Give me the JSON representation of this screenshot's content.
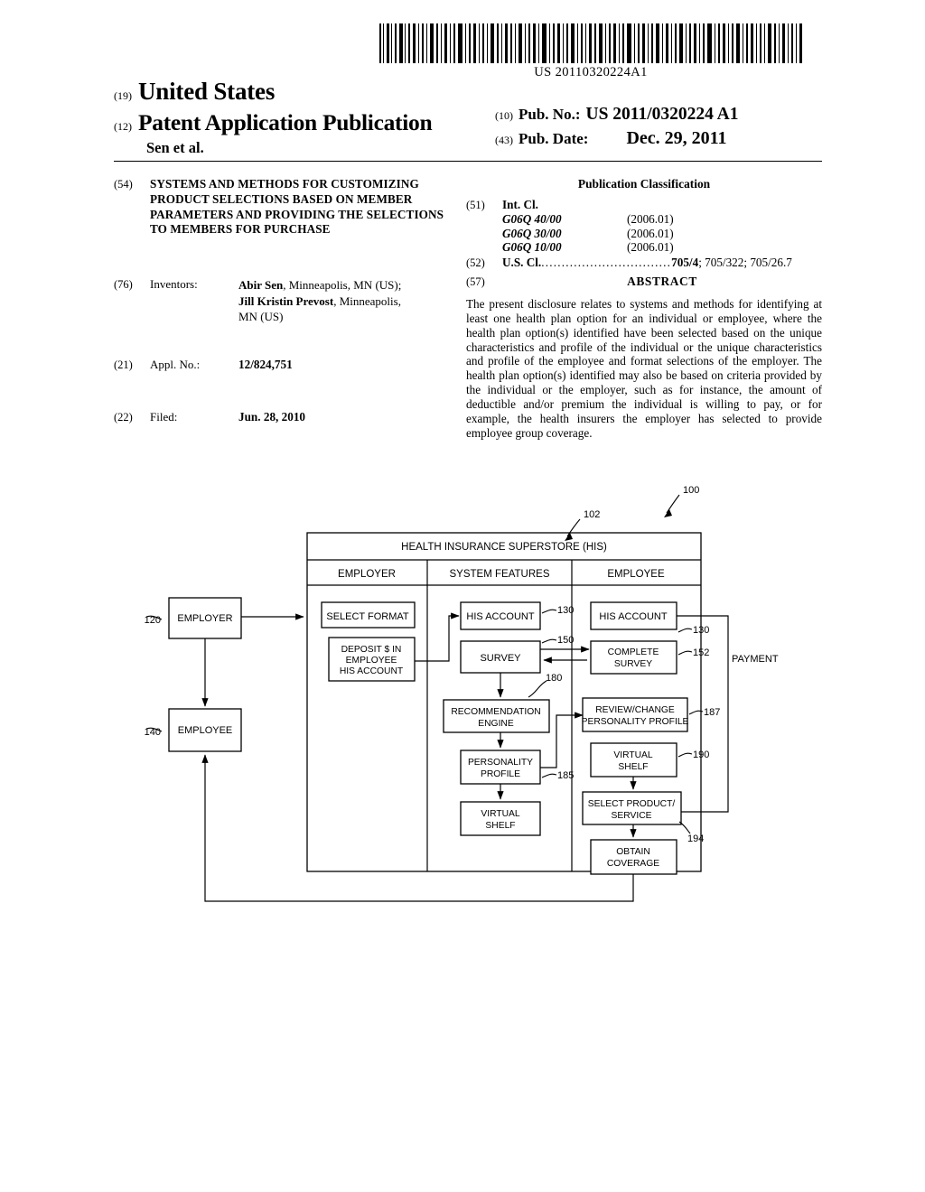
{
  "header": {
    "barcode_number": "US 20110320224A1",
    "country_code": "(19)",
    "country": "United States",
    "doc_code": "(12)",
    "doc_type": "Patent Application Publication",
    "byline": "Sen et al.",
    "pubno_code": "(10)",
    "pubno_label": "Pub. No.:",
    "pubno_value": "US 2011/0320224 A1",
    "pubdate_code": "(43)",
    "pubdate_label": "Pub. Date:",
    "pubdate_value": "Dec. 29, 2011"
  },
  "left_column": {
    "title_code": "(54)",
    "title": "SYSTEMS AND METHODS FOR CUSTOMIZING PRODUCT SELECTIONS BASED ON MEMBER PARAMETERS AND PROVIDING THE SELECTIONS TO MEMBERS FOR PURCHASE",
    "inventors_code": "(76)",
    "inventors_label": "Inventors:",
    "inventors": [
      {
        "name": "Abir Sen",
        "rest": ", Minneapolis, MN (US);"
      },
      {
        "name": "Jill Kristin Prevost",
        "rest": ", Minneapolis,"
      },
      {
        "name": "",
        "rest": "MN (US)"
      }
    ],
    "applno_code": "(21)",
    "applno_label": "Appl. No.:",
    "applno_value": "12/824,751",
    "filed_code": "(22)",
    "filed_label": "Filed:",
    "filed_value": "Jun. 28, 2010"
  },
  "right_column": {
    "pubclass_title": "Publication Classification",
    "intcl_code": "(51)",
    "intcl_label": "Int. Cl.",
    "intcl_entries": [
      {
        "code": "G06Q 40/00",
        "year": "(2006.01)"
      },
      {
        "code": "G06Q 30/00",
        "year": "(2006.01)"
      },
      {
        "code": "G06Q 10/00",
        "year": "(2006.01)"
      }
    ],
    "uscl_code": "(52)",
    "uscl_label": "U.S. Cl.",
    "uscl_dots": "................................",
    "uscl_primary": "705/4",
    "uscl_rest": "; 705/322; 705/26.7",
    "abstract_code": "(57)",
    "abstract_head": "ABSTRACT",
    "abstract_body": "The present disclosure relates to systems and methods for identifying at least one health plan option for an individual or employee, where the health plan option(s) identified have been selected based on the unique characteristics and profile of the individual or the unique characteristics and profile of the employee and format selections of the employer. The health plan option(s) identified may also be based on criteria provided by the individual or the employer, such as for instance, the amount of deductible and/or premium the individual is willing to pay, or for example, the health insurers the employer has selected to provide employee group coverage."
  },
  "figure": {
    "ref_100": "100",
    "ref_102": "102",
    "ref_120": "120",
    "ref_140": "140",
    "his_header": "HEALTH INSURANCE SUPERSTORE (HIS)",
    "col_employer": "EMPLOYER",
    "col_system": "SYSTEM FEATURES",
    "col_employee": "EMPLOYEE",
    "ext_employer": "EMPLOYER",
    "ext_employee": "EMPLOYEE",
    "payment_label": "PAYMENT",
    "employer_boxes": [
      {
        "lines": [
          "SELECT FORMAT"
        ]
      },
      {
        "lines": [
          "DEPOSIT $ IN",
          "EMPLOYEE",
          "HIS ACCOUNT"
        ]
      }
    ],
    "system_boxes": [
      {
        "lines": [
          "HIS ACCOUNT"
        ],
        "ref": "130"
      },
      {
        "lines": [
          "SURVEY"
        ],
        "ref": "150"
      },
      {
        "lines": [
          "RECOMMENDATION",
          "ENGINE"
        ],
        "ref": "180"
      },
      {
        "lines": [
          "PERSONALITY",
          "PROFILE"
        ],
        "ref": "185"
      },
      {
        "lines": [
          "VIRTUAL",
          "SHELF"
        ],
        "ref": ""
      }
    ],
    "employee_boxes": [
      {
        "lines": [
          "HIS ACCOUNT"
        ],
        "ref": "130"
      },
      {
        "lines": [
          "COMPLETE",
          "SURVEY"
        ],
        "ref": "152"
      },
      {
        "lines": [
          "REVIEW/CHANGE",
          "PERSONALITY PROFILE"
        ],
        "ref": "187"
      },
      {
        "lines": [
          "VIRTUAL",
          "SHELF"
        ],
        "ref": "190"
      },
      {
        "lines": [
          "SELECT PRODUCT/",
          "SERVICE"
        ],
        "ref": "194"
      },
      {
        "lines": [
          "OBTAIN",
          "COVERAGE"
        ],
        "ref": ""
      }
    ]
  }
}
